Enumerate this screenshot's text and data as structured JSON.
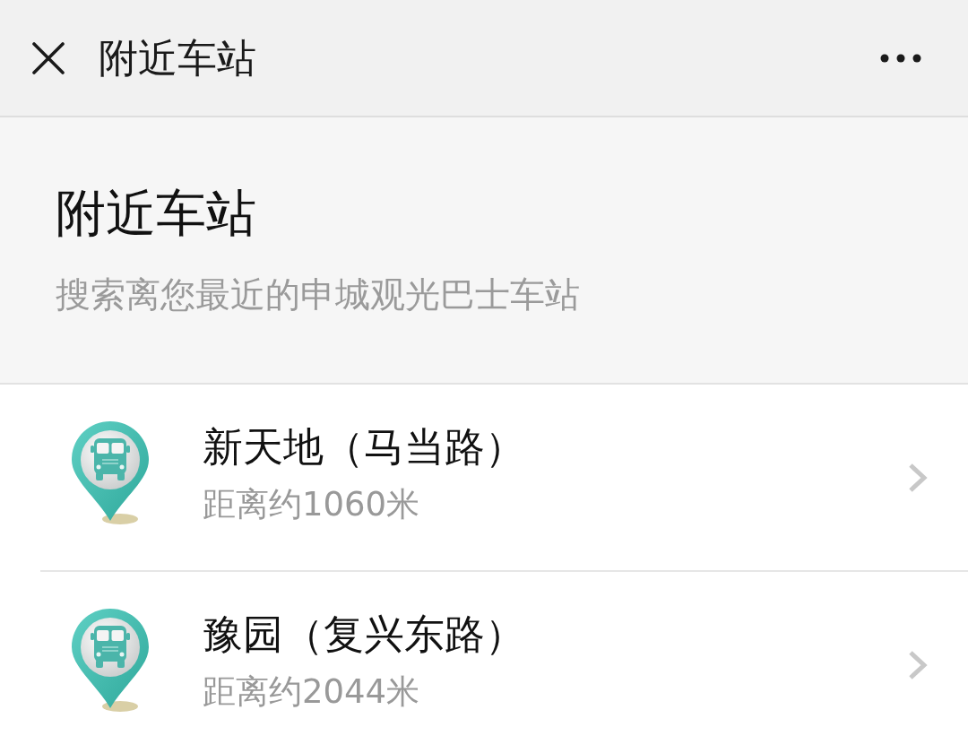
{
  "top_bar": {
    "title": "附近车站"
  },
  "header": {
    "title": "附近车站",
    "subtitle": "搜索离您最近的申城观光巴士车站"
  },
  "stations": [
    {
      "name": "新天地（马当路）",
      "distance": "距离约1060米"
    },
    {
      "name": "豫园（复兴东路）",
      "distance": "距离约2044米"
    }
  ]
}
